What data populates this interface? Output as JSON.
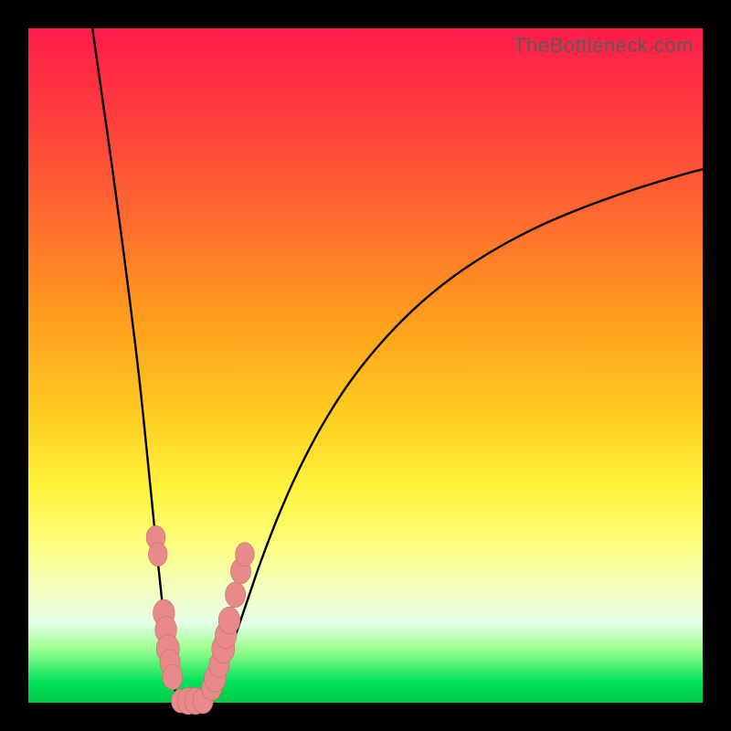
{
  "watermark": "TheBottleneck.com",
  "colors": {
    "curve_stroke": "#000000",
    "marker_fill": "#e88a8a",
    "marker_stroke": "#c76a6a",
    "frame_bg": "#000000"
  },
  "chart_data": {
    "type": "line",
    "title": "",
    "xlabel": "",
    "ylabel": "",
    "xlim": [
      0,
      100
    ],
    "ylim": [
      0,
      100
    ],
    "curves": [
      {
        "name": "left_branch",
        "x": [
          9.5,
          10.5,
          12,
          13.5,
          15,
          16.4,
          17.5,
          18.4,
          19.2,
          19.9,
          20.5,
          21.1,
          21.6,
          21.85,
          22.05,
          22.2
        ],
        "y": [
          100,
          93,
          82.5,
          71.5,
          60,
          48.5,
          38,
          29,
          21,
          14.5,
          9.5,
          5.5,
          2.8,
          1.4,
          0.5,
          0
        ]
      },
      {
        "name": "valley_floor",
        "x": [
          22.2,
          23.2,
          24.2,
          25.1,
          25.9,
          26.7
        ],
        "y": [
          0,
          0,
          0,
          0,
          0,
          0
        ]
      },
      {
        "name": "right_branch",
        "x": [
          26.7,
          27.5,
          28.4,
          29.5,
          30.8,
          32.5,
          34.5,
          37,
          40,
          43.5,
          47.5,
          52,
          57,
          62.5,
          68.5,
          75,
          82,
          89.5,
          97,
          100
        ],
        "y": [
          0,
          1.2,
          3.2,
          6.2,
          10.2,
          15.2,
          21,
          27.5,
          34.3,
          41,
          47.3,
          53,
          58.2,
          62.8,
          66.8,
          70.3,
          73.3,
          76,
          78.3,
          79.1
        ]
      }
    ],
    "markers": [
      {
        "series": "left_points",
        "points": [
          {
            "x": 18.9,
            "y": 24.5,
            "r": 1.4
          },
          {
            "x": 19.2,
            "y": 22.0,
            "r": 1.4
          },
          {
            "x": 20.1,
            "y": 13.3,
            "r": 1.6
          },
          {
            "x": 20.4,
            "y": 10.8,
            "r": 1.6
          },
          {
            "x": 20.7,
            "y": 8.0,
            "r": 1.7
          },
          {
            "x": 21.0,
            "y": 6.0,
            "r": 1.5
          },
          {
            "x": 21.4,
            "y": 3.8,
            "r": 1.5
          }
        ]
      },
      {
        "series": "floor_points",
        "points": [
          {
            "x": 22.6,
            "y": 0.25,
            "r": 1.4
          },
          {
            "x": 23.7,
            "y": 0.25,
            "r": 1.6
          },
          {
            "x": 24.8,
            "y": 0.25,
            "r": 1.6
          },
          {
            "x": 25.9,
            "y": 0.25,
            "r": 1.5
          }
        ]
      },
      {
        "series": "right_points",
        "points": [
          {
            "x": 27.2,
            "y": 2.2,
            "r": 1.5
          },
          {
            "x": 27.7,
            "y": 3.6,
            "r": 1.6
          },
          {
            "x": 28.3,
            "y": 5.6,
            "r": 1.5
          },
          {
            "x": 28.9,
            "y": 8.0,
            "r": 1.7
          },
          {
            "x": 29.3,
            "y": 10.0,
            "r": 1.6
          },
          {
            "x": 29.8,
            "y": 12.2,
            "r": 1.6
          },
          {
            "x": 30.7,
            "y": 16.0,
            "r": 1.5
          },
          {
            "x": 31.5,
            "y": 19.5,
            "r": 1.5
          },
          {
            "x": 32.1,
            "y": 22.0,
            "r": 1.4
          }
        ]
      }
    ]
  }
}
